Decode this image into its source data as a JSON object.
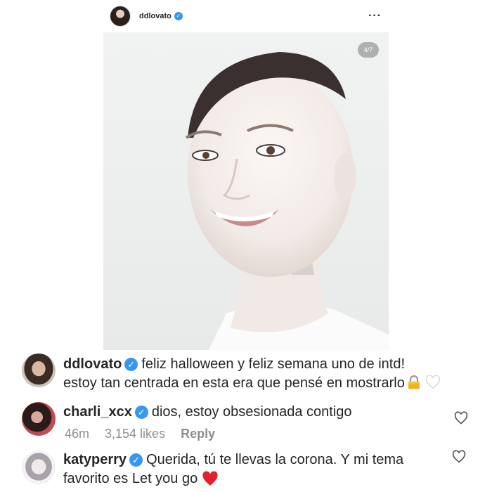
{
  "post": {
    "username": "ddlovato",
    "counter": "4/7"
  },
  "comments": [
    {
      "username": "ddlovato",
      "text_line1": "feliz halloween y feliz semana uno de intd!",
      "text_line2": "estoy tan centrada en esta era que pensé en mostrarlo"
    },
    {
      "username": "charli_xcx",
      "text": "dios, estoy obsesionada contigo",
      "time": "46m",
      "likes": "3,154 likes",
      "reply": "Reply"
    },
    {
      "username": "katyperry",
      "text_line1": "Querida, tú te llevas la corona. Y mi tema",
      "text_line2": "favorito es Let you go"
    }
  ],
  "icons": {
    "verified": "verified-badge-icon",
    "more": "more-options-icon",
    "like": "heart-outline-icon",
    "emoji_lock": "lock-emoji",
    "emoji_white_heart": "white-heart-emoji",
    "emoji_red_heart": "red-heart-emoji"
  },
  "colors": {
    "verified": "#3897f0",
    "meta_text": "#8e8e8e",
    "text": "#262626",
    "red_heart": "#e0202b"
  }
}
